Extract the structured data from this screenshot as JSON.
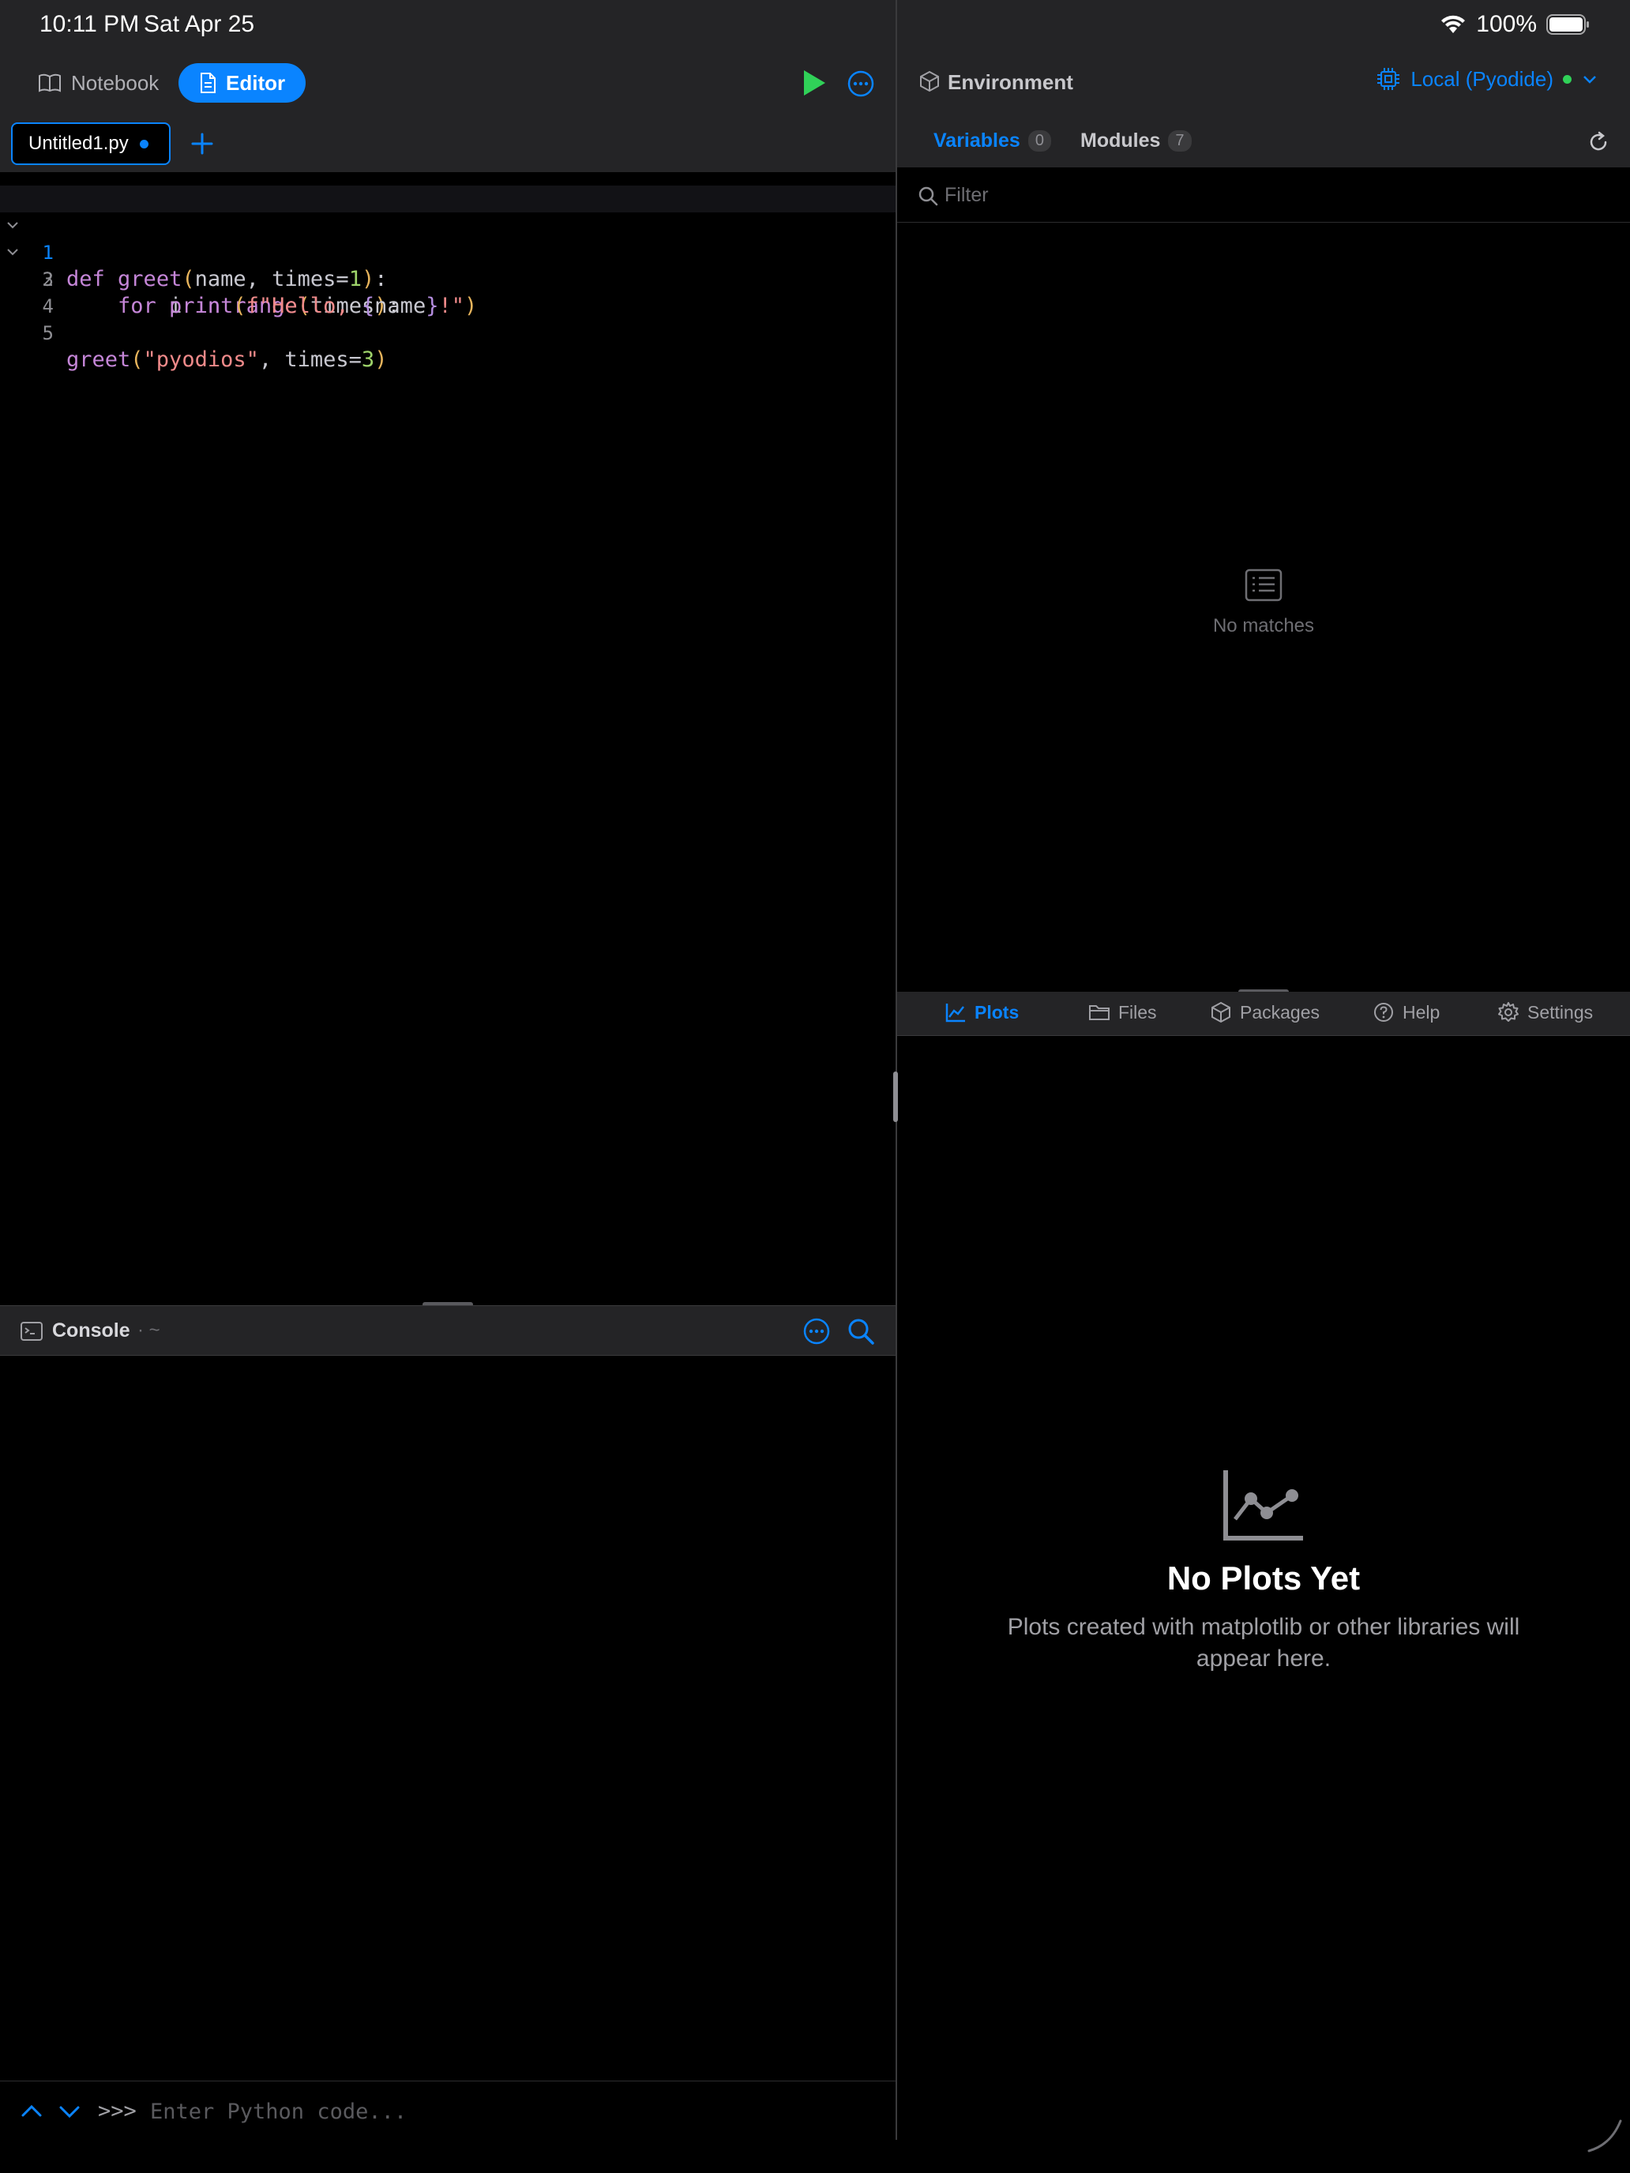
{
  "status": {
    "time": "10:11 PM",
    "date": "Sat Apr 25",
    "battery": "100%"
  },
  "toolbar": {
    "notebook_label": "Notebook",
    "editor_label": "Editor"
  },
  "tabs": {
    "file_name": "Untitled1.py"
  },
  "editor": {
    "line_numbers": [
      "1",
      "2",
      "3",
      "4",
      "5"
    ],
    "tokens": {
      "l1": [
        "def",
        "greet",
        "(",
        "name",
        ", ",
        "times",
        "=",
        "1",
        ")",
        ":"
      ],
      "l2": [
        "    ",
        "for",
        " ",
        "i",
        " ",
        "in",
        " ",
        "range",
        "(",
        "times",
        ")",
        ":"
      ],
      "l3": [
        "        ",
        "print",
        "(",
        "f\"Hello, ",
        "{",
        "name",
        "}",
        "!\"",
        ")"
      ],
      "l5": [
        "greet",
        "(",
        "\"pyodios\"",
        ", ",
        "times",
        "=",
        "3",
        ")"
      ]
    }
  },
  "console": {
    "title": "Console",
    "path": "· ~",
    "prompt": ">>>",
    "input_placeholder": "Enter Python code..."
  },
  "environment": {
    "title": "Environment",
    "runtime": "Local (Pyodide)",
    "tabs": {
      "variables_label": "Variables",
      "variables_count": "0",
      "modules_label": "Modules",
      "modules_count": "7"
    },
    "filter_placeholder": "Filter",
    "empty_text": "No matches"
  },
  "bottom_tabs": {
    "plots": "Plots",
    "files": "Files",
    "packages": "Packages",
    "help": "Help",
    "settings": "Settings"
  },
  "plots": {
    "title": "No Plots Yet",
    "description": "Plots created with matplotlib or other libraries will appear here."
  },
  "colors": {
    "accent": "#0a84ff",
    "run": "#30d158",
    "background": "#000000",
    "chrome": "#242426"
  }
}
